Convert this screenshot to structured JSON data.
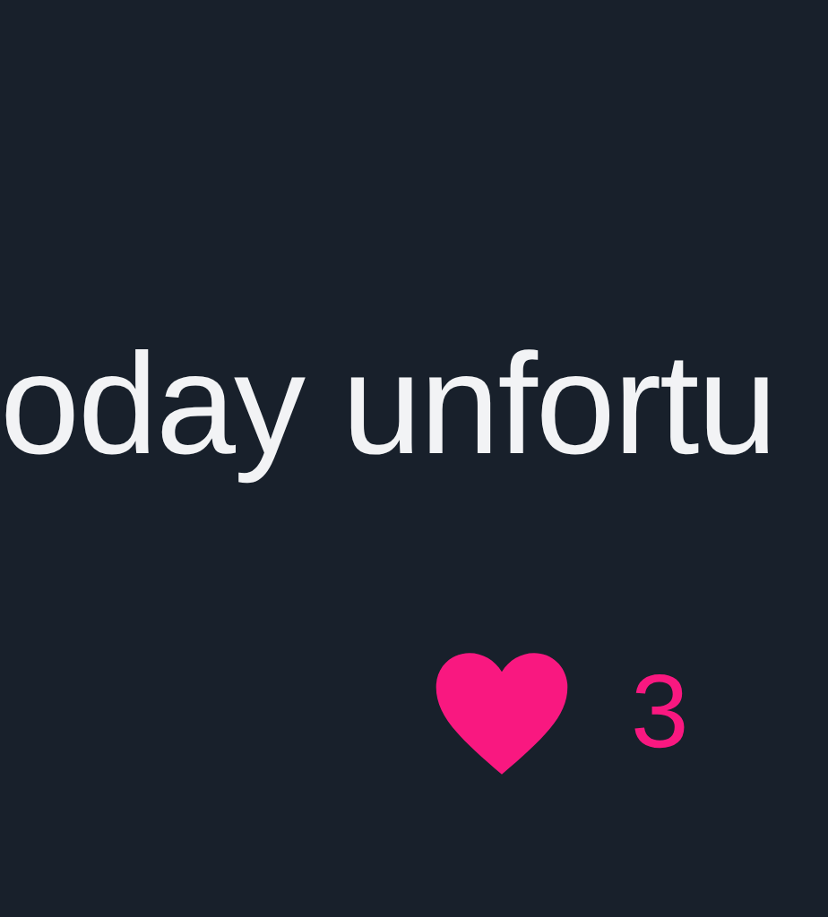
{
  "post": {
    "text": "oday unfortu"
  },
  "like": {
    "liked": true,
    "count": "3"
  }
}
